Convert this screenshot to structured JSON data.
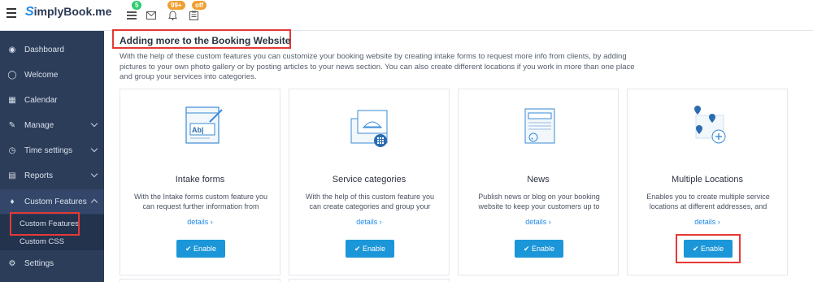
{
  "header": {
    "logo_initial": "S",
    "logo_text": "implyBook.me",
    "icons": [
      {
        "name": "list-icon",
        "badge": "5",
        "badge_color": "#2ecc71"
      },
      {
        "name": "envelope-icon",
        "badge": "",
        "badge_color": ""
      },
      {
        "name": "bell-icon",
        "badge": "99+",
        "badge_color": "#f0a030"
      },
      {
        "name": "clipboard-icon",
        "badge": "off",
        "badge_color": "#f0a030"
      }
    ]
  },
  "sidebar": {
    "items": [
      {
        "label": "Dashboard",
        "icon": "dashboard-icon"
      },
      {
        "label": "Welcome",
        "icon": "lightbulb-icon"
      },
      {
        "label": "Calendar",
        "icon": "calendar-icon"
      },
      {
        "label": "Manage",
        "icon": "pencil-icon"
      },
      {
        "label": "Time settings",
        "icon": "clock-icon"
      },
      {
        "label": "Reports",
        "icon": "chart-icon"
      },
      {
        "label": "Custom Features",
        "icon": "puzzle-icon"
      },
      {
        "label": "Settings",
        "icon": "cogs-icon"
      }
    ],
    "subitems": [
      {
        "label": "Custom Features"
      },
      {
        "label": "Custom CSS"
      }
    ]
  },
  "main": {
    "title": "Adding more to the Booking Website",
    "description": "With the help of these custom features you can customize your booking website by creating intake forms to request more info from clients, by adding pictures to your own photo gallery or by posting articles to your news section. You can also create different locations if you work in more than one place and group your services into categories.",
    "cards": [
      {
        "title": "Intake forms",
        "desc": "With the Intake forms custom feature you can request further information from",
        "details": "details ›",
        "button": "✔ Enable",
        "illu_label": "Ab|"
      },
      {
        "title": "Service categories",
        "desc": "With the help of this custom feature you can create categories and group your",
        "details": "details ›",
        "button": "✔ Enable"
      },
      {
        "title": "News",
        "desc": "Publish news or blog on your booking website to keep your customers up to",
        "details": "details ›",
        "button": "✔ Enable"
      },
      {
        "title": "Multiple Locations",
        "desc": "Enables you to create multiple service locations at different addresses, and",
        "details": "details ›",
        "button": "✔ Enable"
      }
    ]
  },
  "colors": {
    "sidebar_bg": "#2c3d5a",
    "accent": "#1b96d8",
    "highlight": "#e53935"
  }
}
